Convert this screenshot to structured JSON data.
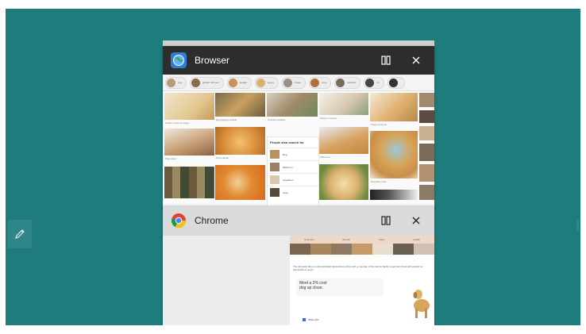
{
  "desktop": {
    "background": "#1f7c7d"
  },
  "recents": {
    "cards": [
      {
        "id": "browser",
        "title": "Browser",
        "icon": "browser-globe-icon",
        "header_color": "#2d2d2d",
        "buttons": [
          "split-screen-icon",
          "close-icon"
        ],
        "thumbnail": {
          "people_also_search_for": "People also search for",
          "people_rows": [
            "Dog",
            "Shiba Inu",
            "Cavachon",
            "Goat"
          ]
        }
      },
      {
        "id": "chrome",
        "title": "Chrome",
        "icon": "chrome-icon",
        "header_color": "#dadada",
        "buttons": [
          "split-screen-icon",
          "close-icon"
        ],
        "thumbnail": {
          "tabs": [
            "Overview",
            "Breeds",
            "Facts",
            "Health"
          ],
          "meet_text": [
            "Meet a 2% cool",
            "dog up close."
          ]
        }
      }
    ]
  },
  "side_tool": {
    "icon": "pen-icon"
  }
}
